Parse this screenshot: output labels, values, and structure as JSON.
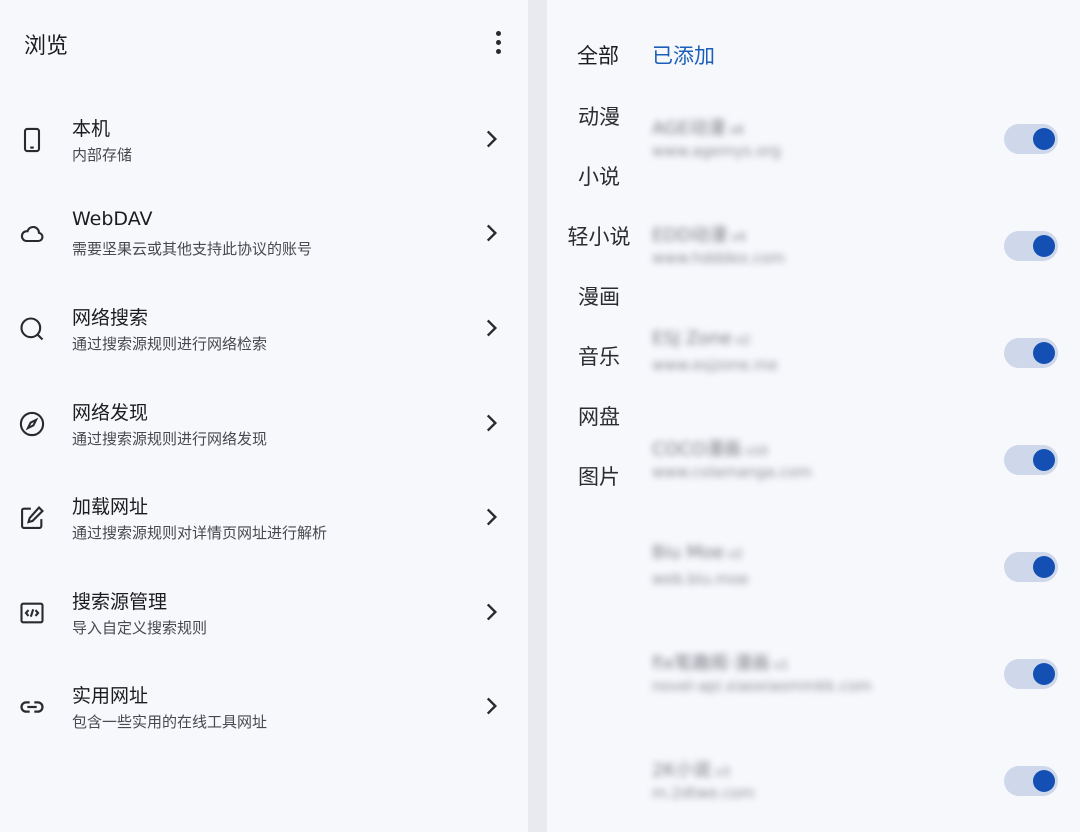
{
  "left": {
    "title": "浏览",
    "items": [
      {
        "icon": "phone-icon",
        "title": "本机",
        "subtitle": "内部存储"
      },
      {
        "icon": "cloud-icon",
        "title": "WebDAV",
        "subtitle": "需要坚果云或其他支持此协议的账号"
      },
      {
        "icon": "search-icon",
        "title": "网络搜索",
        "subtitle": "通过搜索源规则进行网络检索"
      },
      {
        "icon": "compass-icon",
        "title": "网络发现",
        "subtitle": "通过搜索源规则进行网络发现"
      },
      {
        "icon": "edit-icon",
        "title": "加载网址",
        "subtitle": "通过搜索源规则对详情页网址进行解析"
      },
      {
        "icon": "code-icon",
        "title": "搜索源管理",
        "subtitle": "导入自定义搜索规则"
      },
      {
        "icon": "link-icon",
        "title": "实用网址",
        "subtitle": "包含一些实用的在线工具网址"
      }
    ]
  },
  "right": {
    "tabs": {
      "all": "全部",
      "added": "已添加"
    },
    "categories": [
      "动漫",
      "小说",
      "轻小说",
      "漫画",
      "音乐",
      "网盘",
      "图片"
    ],
    "sources": [
      {
        "name": "AGE动漫",
        "version": "v6",
        "url": "www.agemys.org",
        "enabled": true
      },
      {
        "name": "EDD动漫",
        "version": "v4",
        "url": "www.hdddex.com",
        "enabled": true
      },
      {
        "name": "ESJ Zone",
        "version": "v2",
        "url": "www.esjzone.me",
        "enabled": true
      },
      {
        "name": "COCO漫画",
        "version": "v10",
        "url": "www.colamanga.com",
        "enabled": true
      },
      {
        "name": "Biu Moe",
        "version": "v2",
        "url": "web.biu.moe",
        "enabled": true
      },
      {
        "name": "fix笔趣阁·漫画",
        "version": "v1",
        "url": "novel-api.xiaoxiaommkk.com",
        "enabled": true
      },
      {
        "name": "2K小说",
        "version": "v3",
        "url": "m.2dtwe.com",
        "enabled": true
      }
    ]
  },
  "colors": {
    "accent": "#1c5fb8",
    "toggle_knob": "#1450b4",
    "toggle_track": "#cfd8ea",
    "background": "#f7f8fc"
  }
}
